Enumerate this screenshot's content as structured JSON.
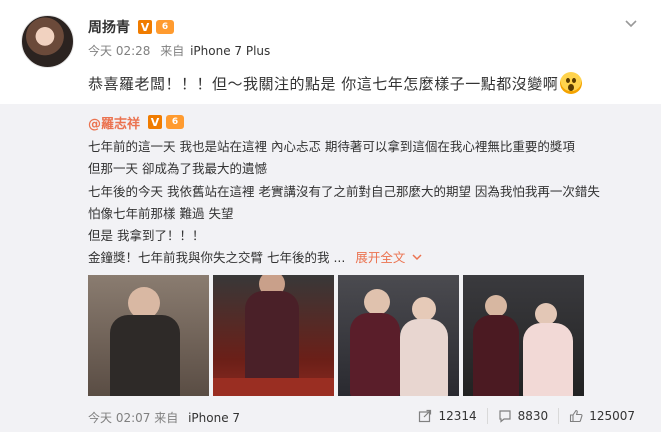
{
  "post": {
    "author": "周扬青",
    "time": "今天 02:28",
    "source_prefix": "来自",
    "device": "iPhone 7 Plus",
    "text": "恭喜羅老闆！！！但～我關注的點是 你這七年怎麼樣子一點都沒變啊",
    "badge_v": "V",
    "badge_vip": "6"
  },
  "repost": {
    "author": "@羅志祥",
    "badge_v": "V",
    "badge_vip": "6",
    "lines": [
      "七年前的這一天 我也是站在這裡 內心忐忑 期待著可以拿到這個在我心裡無比重要的獎項",
      "但那一天 卻成為了我最大的遺憾",
      "七年後的今天 我依舊站在這裡 老實講沒有了之前對自己那麼大的期望 因為我怕我再一次錯失",
      "怕像七年前那樣 難過 失望",
      "但是 我拿到了！！！"
    ],
    "teaser": "金鐘獎！七年前我與你失之交臂 七年後的我 ...",
    "expand": "展开全文",
    "expand_chevron": "chevron-down-icon",
    "footer_time": "今天 02:07",
    "footer_source": "来自",
    "footer_device": "iPhone 7",
    "reposts": "12314",
    "comments": "8830",
    "likes": "125007"
  }
}
